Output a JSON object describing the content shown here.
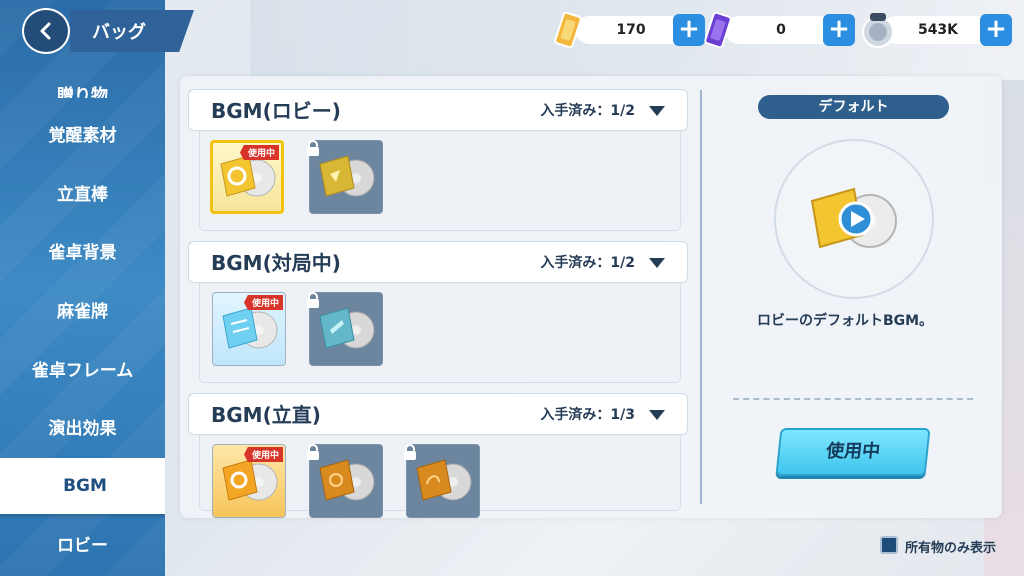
{
  "header": {
    "title": "バッグ",
    "currencies": [
      {
        "icon": "gold-ticket-icon",
        "value": "170"
      },
      {
        "icon": "purple-ticket-icon",
        "value": "0"
      },
      {
        "icon": "coin-icon",
        "value": "543K"
      }
    ],
    "plus_label": "+"
  },
  "sidebar": {
    "items": [
      {
        "label": "贈り物"
      },
      {
        "label": "覚醒素材"
      },
      {
        "label": "立直棒"
      },
      {
        "label": "雀卓背景"
      },
      {
        "label": "麻雀牌"
      },
      {
        "label": "雀卓フレーム"
      },
      {
        "label": "演出効果"
      },
      {
        "label": "BGM",
        "active": true
      },
      {
        "label": "ロビー"
      }
    ]
  },
  "sections": [
    {
      "name": "BGM(ロビー)",
      "count": "入手済み：1/2",
      "items": [
        {
          "tag": "使用中",
          "locked": false,
          "selected": true
        },
        {
          "locked": true
        }
      ]
    },
    {
      "name": "BGM(対局中)",
      "count": "入手済み：1/2",
      "items": [
        {
          "tag": "使用中",
          "locked": false
        },
        {
          "locked": true
        }
      ]
    },
    {
      "name": "BGM(立直)",
      "count": "入手済み：1/3",
      "items": [
        {
          "tag": "使用中",
          "locked": false
        },
        {
          "locked": true
        },
        {
          "locked": true
        }
      ]
    }
  ],
  "detail": {
    "title": "デフォルト",
    "description": "ロビーのデフォルトBGM。",
    "button": "使用中"
  },
  "footer": {
    "owned_only_label": "所有物のみ表示"
  },
  "colors": {
    "sidebar": "#2a6ca8",
    "accent_button": "#3fc5ee",
    "tag_red": "#d9342a",
    "selected_border": "#f1c30f"
  }
}
